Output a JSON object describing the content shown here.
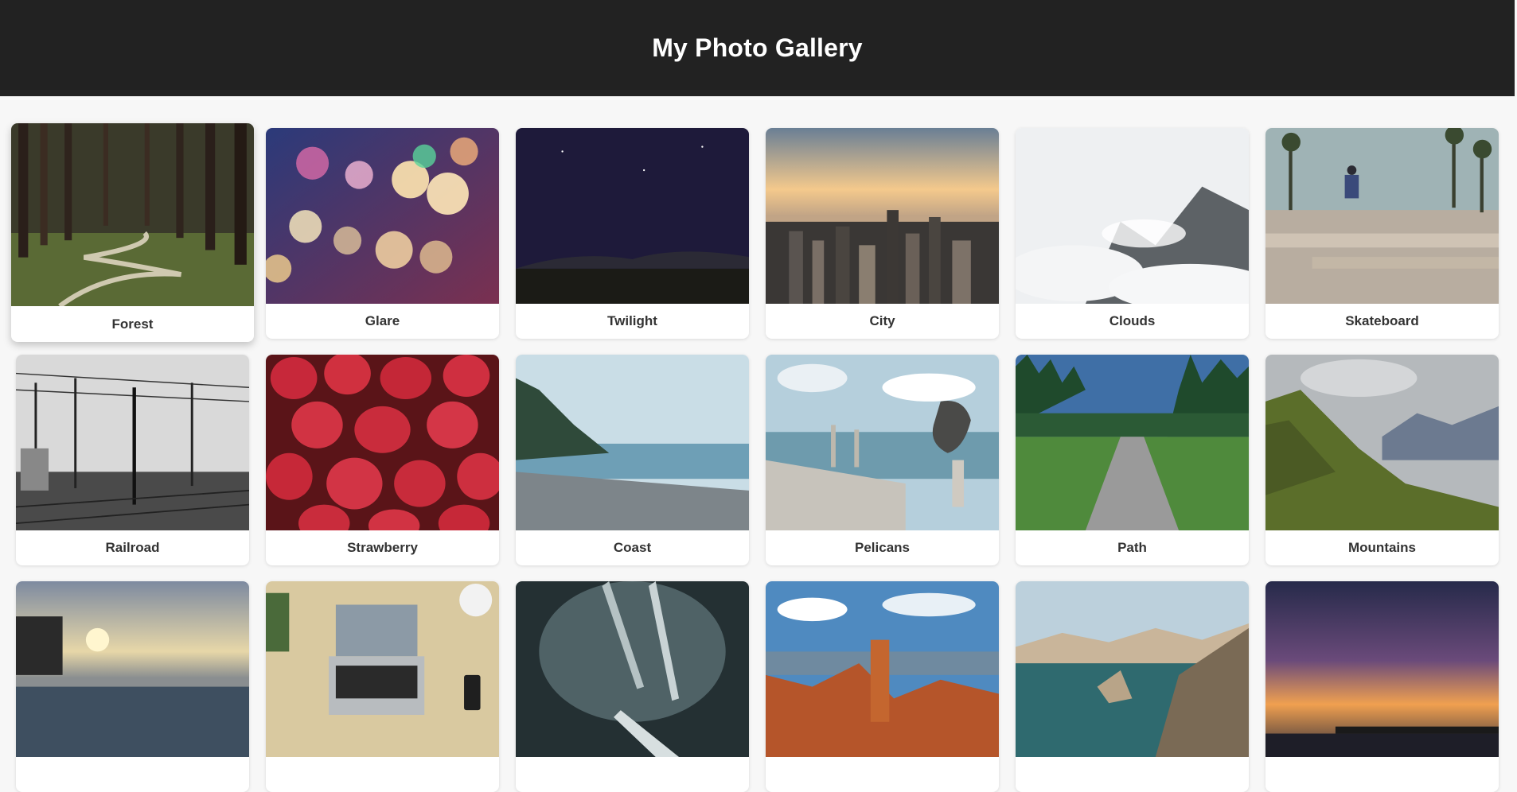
{
  "header": {
    "title": "My Photo Gallery"
  },
  "gallery": {
    "photos": [
      {
        "caption": "Forest",
        "icon": "forest-photo",
        "hovered": true
      },
      {
        "caption": "Glare",
        "icon": "bokeh-photo"
      },
      {
        "caption": "Twilight",
        "icon": "night-sky-photo"
      },
      {
        "caption": "City",
        "icon": "city-photo"
      },
      {
        "caption": "Clouds",
        "icon": "mountain-clouds-photo"
      },
      {
        "caption": "Skateboard",
        "icon": "skatepark-photo"
      },
      {
        "caption": "Railroad",
        "icon": "railroad-photo"
      },
      {
        "caption": "Strawberry",
        "icon": "strawberries-photo"
      },
      {
        "caption": "Coast",
        "icon": "coast-photo"
      },
      {
        "caption": "Pelicans",
        "icon": "pelicans-pier-photo"
      },
      {
        "caption": "Path",
        "icon": "path-photo"
      },
      {
        "caption": "Mountains",
        "icon": "mountains-photo"
      },
      {
        "caption": "",
        "icon": "pier-sunset-photo"
      },
      {
        "caption": "",
        "icon": "laptop-desk-photo"
      },
      {
        "caption": "",
        "icon": "forks-photo"
      },
      {
        "caption": "",
        "icon": "canyon-photo"
      },
      {
        "caption": "",
        "icon": "sea-cliffs-photo"
      },
      {
        "caption": "",
        "icon": "sunset-pier-photo"
      }
    ]
  },
  "colors": {
    "header_bg": "#222222",
    "page_bg": "#f7f7f7",
    "card_bg": "#ffffff",
    "caption_text": "#333333"
  }
}
